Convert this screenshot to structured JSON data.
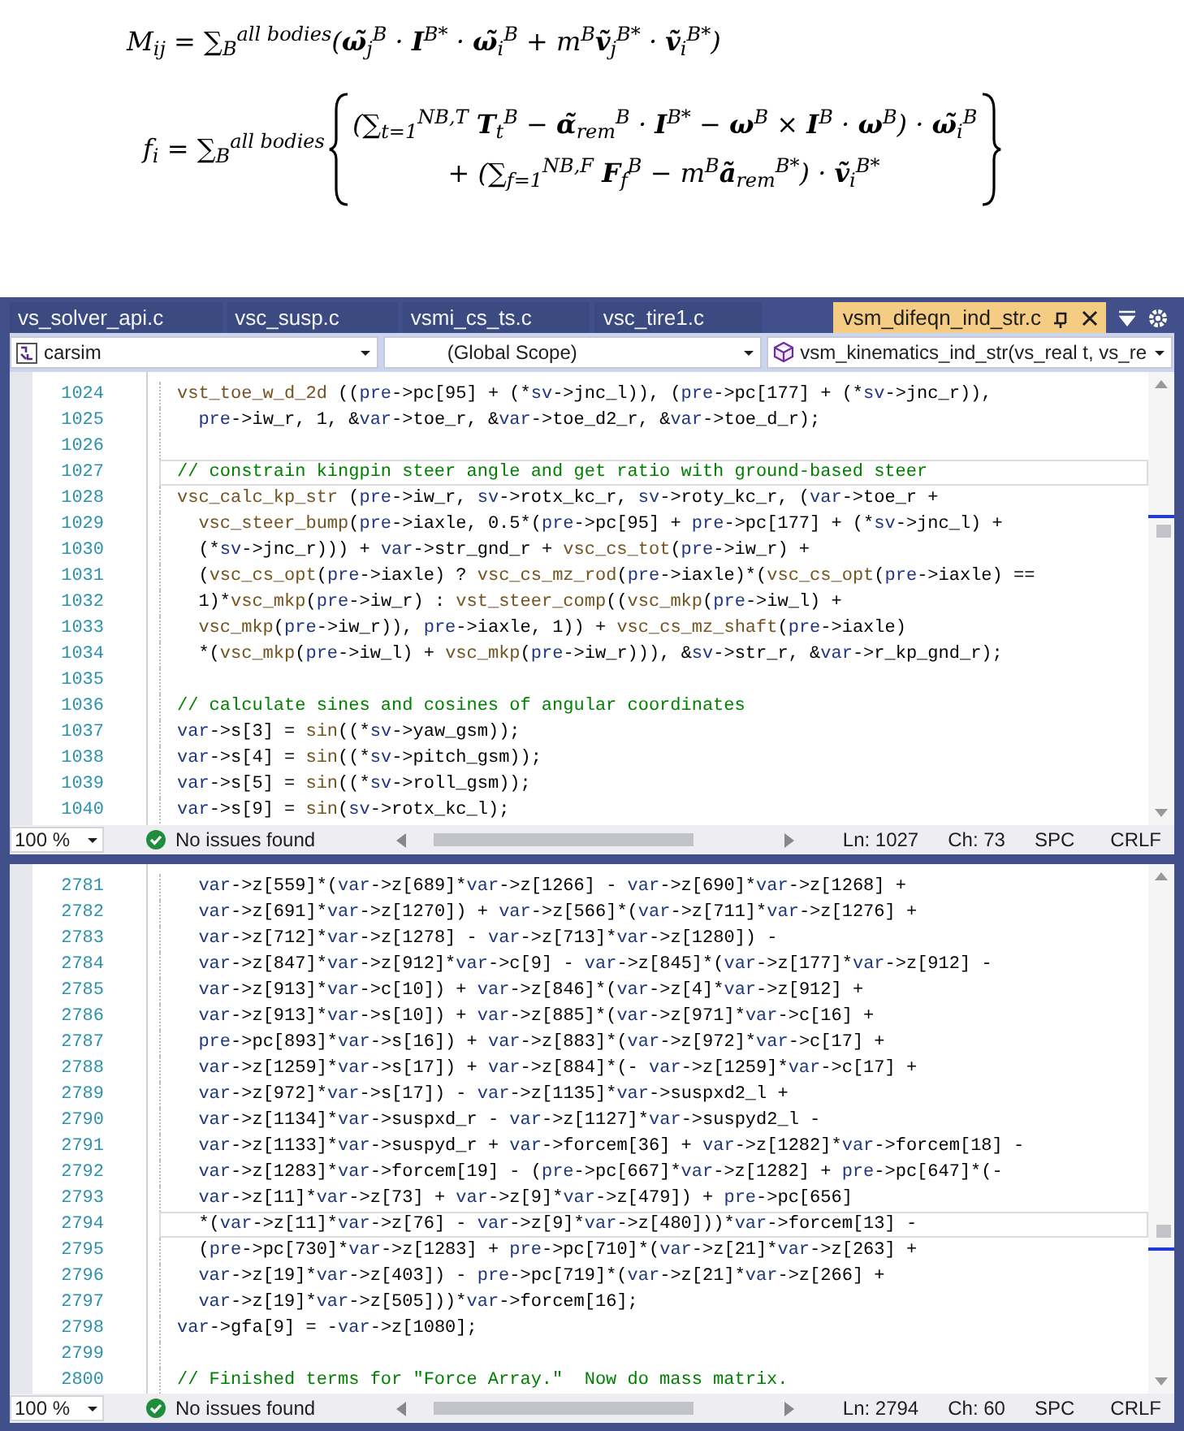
{
  "equations": [
    {
      "kind": "single",
      "text": "M$_{ij}$ = ∑$_{B}$$^{all bodies}$(**ω̃**$_{j}$$^{B}$ · **I**$^{B*}$ · **ω̃**$_{i}$$^{B}$ + m$^{B}$**ṽ**$_{j}$$^{B*}$ · **ṽ**$_{i}$$^{B*}$)"
    },
    {
      "kind": "braced",
      "lhs": "f$_{i}$ = ∑$_{B}$$^{all bodies}$",
      "lines": [
        "(∑$_{t=1}$$^{NB,T}$ **T**$_{t}$$^{B}$ − **α̃**$_{rem}$$^{B}$ · **I**$^{B*}$ − **ω**$^{B}$ × **I**$^{B}$ · **ω**$^{B}$) · **ω̃**$_{i}$$^{B}$",
        "+ (∑$_{f=1}$$^{NB,F}$ **F**$_{f}$$^{B}$ − m$^{B}$**ã**$_{rem}$$^{B*}$) · **ṽ**$_{i}$$^{B*}$"
      ]
    }
  ],
  "editor": {
    "tabs": [
      {
        "label": "vs_solver_api.c",
        "selected": false
      },
      {
        "label": "vsc_susp.c",
        "selected": false
      },
      {
        "label": "vsmi_cs_ts.c",
        "selected": false
      },
      {
        "label": "vsc_tire1.c",
        "selected": false
      },
      {
        "label": "vsm_difeqn_ind_str.c",
        "selected": true
      }
    ],
    "navigation": {
      "project": "carsim",
      "scope": "(Global Scope)",
      "member": "vsm_kinematics_ind_str(vs_real t, vs_re"
    },
    "panes": [
      {
        "lines": [
          {
            "number": "1024",
            "kind": "code",
            "current": false,
            "code": "vst_toe_w_d_2d ((pre->pc[95] + (*sv->jnc_l)), (pre->pc[177] + (*sv->jnc_r)),"
          },
          {
            "number": "1025",
            "kind": "code",
            "current": false,
            "code": "  pre->iw_r, 1, &var->toe_r, &var->toe_d2_r, &var->toe_d_r);"
          },
          {
            "number": "1026",
            "kind": "blank",
            "current": false
          },
          {
            "number": "1027",
            "kind": "comment",
            "current": true,
            "code": "// constrain kingpin steer angle and get ratio with ground-based steer"
          },
          {
            "number": "1028",
            "kind": "code",
            "current": false,
            "code": "vsc_calc_kp_str (pre->iw_r, sv->rotx_kc_r, sv->roty_kc_r, (var->toe_r +"
          },
          {
            "number": "1029",
            "kind": "code",
            "current": false,
            "code": "  vsc_steer_bump(pre->iaxle, 0.5*(pre->pc[95] + pre->pc[177] + (*sv->jnc_l) +"
          },
          {
            "number": "1030",
            "kind": "code",
            "current": false,
            "code": "  (*sv->jnc_r))) + var->str_gnd_r + vsc_cs_tot(pre->iw_r) +"
          },
          {
            "number": "1031",
            "kind": "code",
            "current": false,
            "code": "  (vsc_cs_opt(pre->iaxle) ? vsc_cs_mz_rod(pre->iaxle)*(vsc_cs_opt(pre->iaxle) =="
          },
          {
            "number": "1032",
            "kind": "code",
            "current": false,
            "code": "  1)*vsc_mkp(pre->iw_r) : vst_steer_comp((vsc_mkp(pre->iw_l) +"
          },
          {
            "number": "1033",
            "kind": "code",
            "current": false,
            "code": "  vsc_mkp(pre->iw_r)), pre->iaxle, 1)) + vsc_cs_mz_shaft(pre->iaxle)"
          },
          {
            "number": "1034",
            "kind": "code",
            "current": false,
            "code": "  *(vsc_mkp(pre->iw_l) + vsc_mkp(pre->iw_r))), &sv->str_r, &var->r_kp_gnd_r);"
          },
          {
            "number": "1035",
            "kind": "blank",
            "current": false
          },
          {
            "number": "1036",
            "kind": "comment",
            "current": false,
            "code": "// calculate sines and cosines of angular coordinates"
          },
          {
            "number": "1037",
            "kind": "code",
            "current": false,
            "code": "var->s[3] = sin((*sv->yaw_gsm));"
          },
          {
            "number": "1038",
            "kind": "code",
            "current": false,
            "code": "var->s[4] = sin((*sv->pitch_gsm));"
          },
          {
            "number": "1039",
            "kind": "code",
            "current": false,
            "code": "var->s[5] = sin((*sv->roll_gsm));"
          },
          {
            "number": "1040",
            "kind": "code",
            "current": false,
            "code": "var->s[9] = sin(sv->rotx_kc_l);"
          }
        ],
        "status": {
          "zoom": "100 %",
          "issues": "No issues found",
          "line": "Ln: 1027",
          "column": "Ch: 73",
          "indent": "SPC",
          "line_ending": "CRLF"
        }
      },
      {
        "lines": [
          {
            "number": "2781",
            "kind": "code",
            "current": false,
            "code": "  var->z[559]*(var->z[689]*var->z[1266] - var->z[690]*var->z[1268] +"
          },
          {
            "number": "2782",
            "kind": "code",
            "current": false,
            "code": "  var->z[691]*var->z[1270]) + var->z[566]*(var->z[711]*var->z[1276] +"
          },
          {
            "number": "2783",
            "kind": "code",
            "current": false,
            "code": "  var->z[712]*var->z[1278] - var->z[713]*var->z[1280]) -"
          },
          {
            "number": "2784",
            "kind": "code",
            "current": false,
            "code": "  var->z[847]*var->z[912]*var->c[9] - var->z[845]*(var->z[177]*var->z[912] -"
          },
          {
            "number": "2785",
            "kind": "code",
            "current": false,
            "code": "  var->z[913]*var->c[10]) + var->z[846]*(var->z[4]*var->z[912] +"
          },
          {
            "number": "2786",
            "kind": "code",
            "current": false,
            "code": "  var->z[913]*var->s[10]) + var->z[885]*(var->z[971]*var->c[16] +"
          },
          {
            "number": "2787",
            "kind": "code",
            "current": false,
            "code": "  pre->pc[893]*var->s[16]) + var->z[883]*(var->z[972]*var->c[17] +"
          },
          {
            "number": "2788",
            "kind": "code",
            "current": false,
            "code": "  var->z[1259]*var->s[17]) + var->z[884]*(- var->z[1259]*var->c[17] +"
          },
          {
            "number": "2789",
            "kind": "code",
            "current": false,
            "code": "  var->z[972]*var->s[17]) - var->z[1135]*var->suspxd2_l +"
          },
          {
            "number": "2790",
            "kind": "code",
            "current": false,
            "code": "  var->z[1134]*var->suspxd_r - var->z[1127]*var->suspyd2_l -"
          },
          {
            "number": "2791",
            "kind": "code",
            "current": false,
            "code": "  var->z[1133]*var->suspyd_r + var->forcem[36] + var->z[1282]*var->forcem[18] -"
          },
          {
            "number": "2792",
            "kind": "code",
            "current": false,
            "code": "  var->z[1283]*var->forcem[19] - (pre->pc[667]*var->z[1282] + pre->pc[647]*(-"
          },
          {
            "number": "2793",
            "kind": "code",
            "current": false,
            "code": "  var->z[11]*var->z[73] + var->z[9]*var->z[479]) + pre->pc[656]"
          },
          {
            "number": "2794",
            "kind": "code",
            "current": true,
            "code": "  *(var->z[11]*var->z[76] - var->z[9]*var->z[480]))*var->forcem[13] -"
          },
          {
            "number": "2795",
            "kind": "code",
            "current": false,
            "code": "  (pre->pc[730]*var->z[1283] + pre->pc[710]*(var->z[21]*var->z[263] +"
          },
          {
            "number": "2796",
            "kind": "code",
            "current": false,
            "code": "  var->z[19]*var->z[403]) - pre->pc[719]*(var->z[21]*var->z[266] +"
          },
          {
            "number": "2797",
            "kind": "code",
            "current": false,
            "code": "  var->z[19]*var->z[505]))*var->forcem[16];"
          },
          {
            "number": "2798",
            "kind": "code",
            "current": false,
            "code": "var->gfa[9] = -var->z[1080];"
          },
          {
            "number": "2799",
            "kind": "blank",
            "current": false
          },
          {
            "number": "2800",
            "kind": "comment",
            "current": false,
            "code": "// Finished terms for \"Force Array.\"  Now do mass matrix."
          }
        ],
        "status": {
          "zoom": "100 %",
          "issues": "No issues found",
          "line": "Ln: 2794",
          "column": "Ch: 60",
          "indent": "SPC",
          "line_ending": "CRLF"
        }
      }
    ]
  }
}
